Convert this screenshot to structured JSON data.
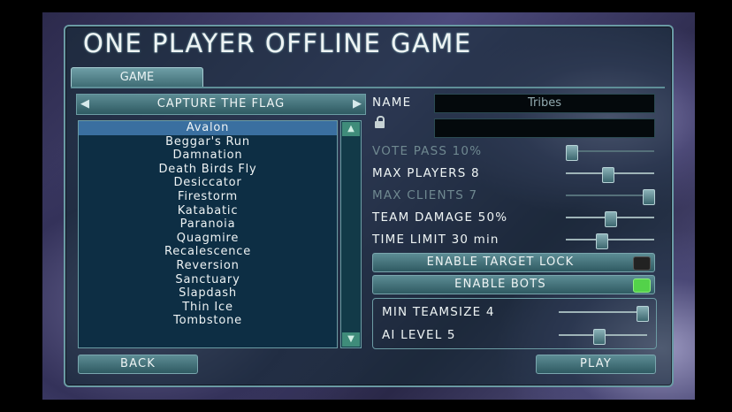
{
  "title": "ONE PLAYER OFFLINE GAME",
  "tab": "GAME",
  "game_mode": "CAPTURE THE FLAG",
  "maps": [
    "Avalon",
    "Beggar's Run",
    "Damnation",
    "Death Birds Fly",
    "Desiccator",
    "Firestorm",
    "Katabatic",
    "Paranoia",
    "Quagmire",
    "Recalescence",
    "Reversion",
    "Sanctuary",
    "Slapdash",
    "Thin Ice",
    "Tombstone"
  ],
  "selected_map": "Avalon",
  "settings": {
    "name_label": "NAME",
    "name_value": "Tribes",
    "password_value": "",
    "vote_pass": "VOTE PASS 10%",
    "vote_pass_level": 0.06,
    "max_players": "MAX PLAYERS 8",
    "max_players_level": 0.47,
    "max_clients": "MAX CLIENTS 7",
    "max_clients_level": 0.93,
    "team_damage": "TEAM DAMAGE 50%",
    "team_damage_level": 0.5,
    "time_limit": "TIME LIMIT 30 min",
    "time_limit_level": 0.4,
    "target_lock_label": "ENABLE TARGET LOCK",
    "target_lock_on": false,
    "bots_label": "ENABLE BOTS",
    "bots_on": true,
    "min_teamsize": "MIN TEAMSIZE 4",
    "min_teamsize_level": 0.94,
    "ai_level": "AI LEVEL 5",
    "ai_level_level": 0.45
  },
  "back_label": "BACK",
  "play_label": "PLAY",
  "colors": {
    "panel": "#2f5a62",
    "selected": "#3a6fa0",
    "bots_led": "#53d24a"
  }
}
